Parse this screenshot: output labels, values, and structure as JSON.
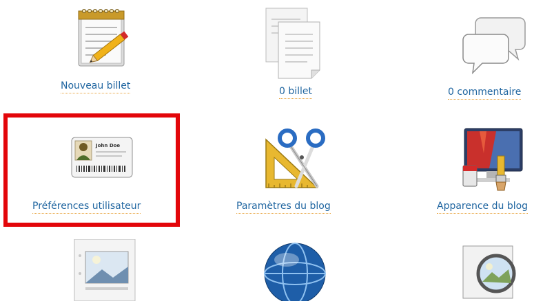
{
  "dashboard": {
    "tiles": [
      {
        "label": "Nouveau billet",
        "icon": "notepad-pencil-icon"
      },
      {
        "label": "0 billet",
        "icon": "documents-icon"
      },
      {
        "label": "0 commentaire",
        "icon": "speech-bubbles-icon"
      },
      {
        "label": "Préférences utilisateur",
        "icon": "user-id-card-icon",
        "id_card_name": "John Doe"
      },
      {
        "label": "Paramètres du blog",
        "icon": "scissors-set-square-icon"
      },
      {
        "label": "Apparence du blog",
        "icon": "paint-monitor-icon"
      },
      {
        "label": "",
        "icon": "media-document-icon"
      },
      {
        "label": "",
        "icon": "globe-icon"
      },
      {
        "label": "",
        "icon": "magnifier-picture-icon"
      }
    ]
  },
  "colors": {
    "link": "#1f65a0",
    "link_underline": "#e8a33c",
    "highlight_border": "#e3060a"
  }
}
